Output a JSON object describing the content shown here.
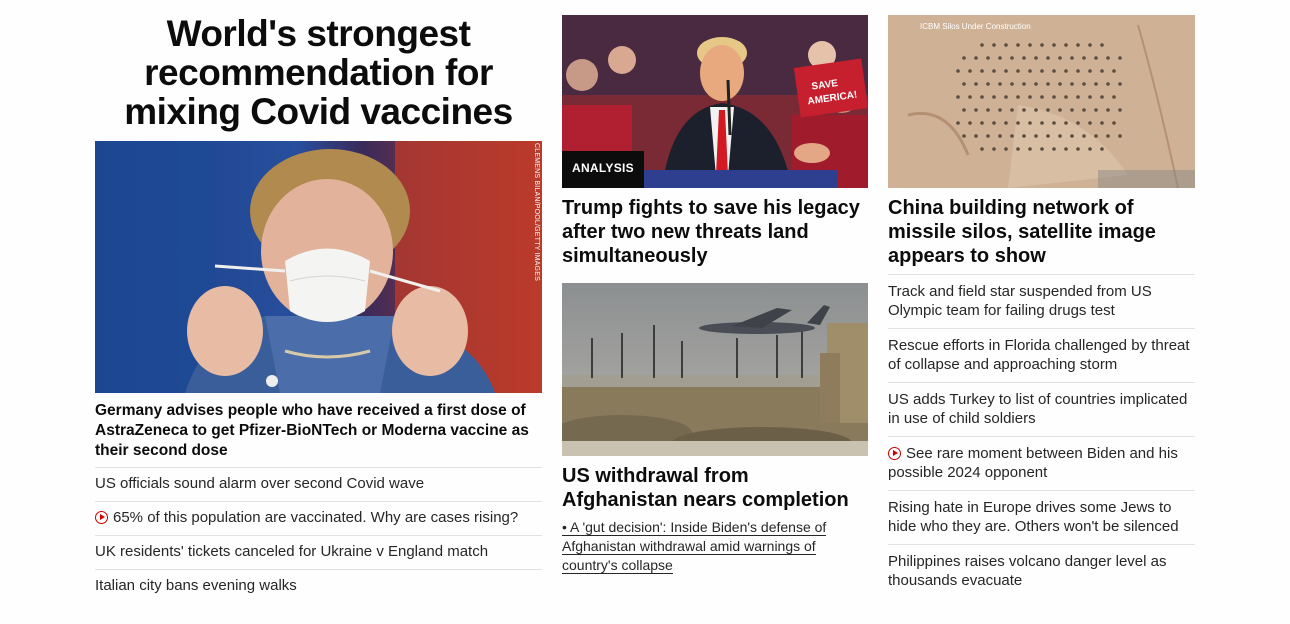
{
  "colors": {
    "accent": "#cc0000",
    "text": "#0c0c0c",
    "divider": "#e2e2e2"
  },
  "col1": {
    "headline": "World's strongest recommendation for mixing Covid vaccines",
    "image_credit": "CLEMENS BILAN/POOL/GETTY IMAGES",
    "lead": "Germany advises people who have received a first dose of AstraZeneca to get Pfizer-BioNTech or Moderna vaccine as their second dose",
    "links": [
      {
        "text": "US officials sound alarm over second Covid wave",
        "icon": ""
      },
      {
        "text": "65% of this population are vaccinated. Why are cases rising?",
        "icon": "play-icon"
      },
      {
        "text": "UK residents' tickets canceled for Ukraine v England match",
        "icon": ""
      },
      {
        "text": "Italian city bans evening walks",
        "icon": ""
      }
    ]
  },
  "col2": {
    "story1": {
      "badge": "ANALYSIS",
      "headline": "Trump fights to save his legacy after two new threats land simultaneously"
    },
    "story2": {
      "headline": "US withdrawal from Afghanistan nears completion",
      "sublink": "• A 'gut decision': Inside Biden's defense of Afghanistan withdrawal amid warnings of country's collapse"
    }
  },
  "col3": {
    "headline": "China building network of missile silos, satellite image appears to show",
    "image_caption": "ICBM Silos Under Construction",
    "links": [
      {
        "text": "Track and field star suspended from US Olympic team for failing drugs test",
        "icon": ""
      },
      {
        "text": "Rescue efforts in Florida challenged by threat of collapse and approaching storm",
        "icon": ""
      },
      {
        "text": "US adds Turkey to list of countries implicated in use of child soldiers",
        "icon": ""
      },
      {
        "text": "See rare moment between Biden and his possible 2024 opponent",
        "icon": "play-icon"
      },
      {
        "text": "Rising hate in Europe drives some Jews to hide who they are. Others won't be silenced",
        "icon": ""
      },
      {
        "text": "Philippines raises volcano danger level as thousands evacuate",
        "icon": ""
      }
    ]
  }
}
